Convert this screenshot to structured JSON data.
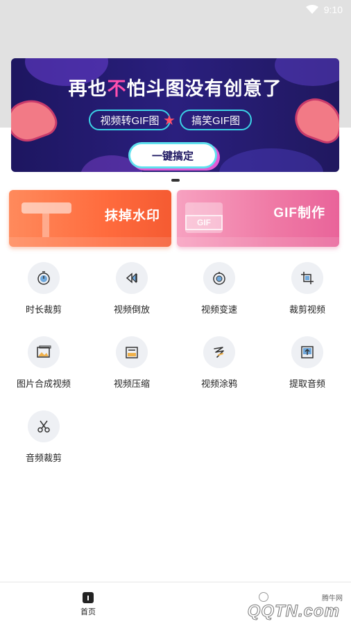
{
  "status_bar": {
    "time": "9:10"
  },
  "banner": {
    "title_part1": "再也",
    "title_highlight": "不",
    "title_part2": "怕斗图没有创意了",
    "pill_left": "视频转GIF图",
    "pill_right": "搞笑GIF图",
    "cta": "一键搞定"
  },
  "promos": [
    {
      "label": "抹掉水印"
    },
    {
      "label": "GIF制作",
      "badge": "GIF"
    }
  ],
  "tools": [
    {
      "label": "时长裁剪",
      "icon": "timer-icon"
    },
    {
      "label": "视频倒放",
      "icon": "rewind-icon"
    },
    {
      "label": "视频变速",
      "icon": "speed-icon"
    },
    {
      "label": "裁剪视频",
      "icon": "crop-icon"
    },
    {
      "label": "图片合成视频",
      "icon": "image-icon"
    },
    {
      "label": "视频压缩",
      "icon": "compress-icon"
    },
    {
      "label": "视频涂鸦",
      "icon": "doodle-icon"
    },
    {
      "label": "提取音频",
      "icon": "extract-audio-icon"
    },
    {
      "label": "音频裁剪",
      "icon": "scissors-icon"
    }
  ],
  "tabbar": {
    "home": "首页"
  },
  "watermark": {
    "text": "腾牛网",
    "logo": "QQTN.com"
  }
}
